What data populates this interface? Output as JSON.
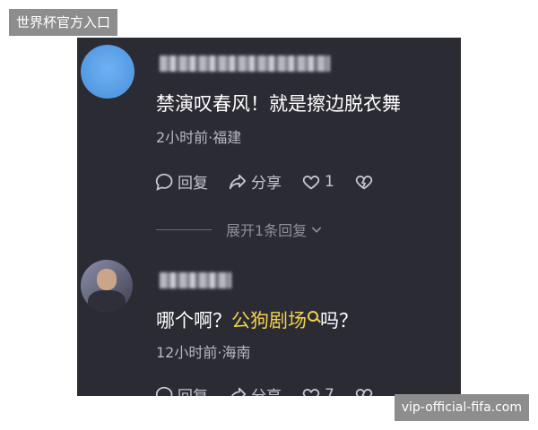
{
  "watermark_top": "世界杯官方入口",
  "watermark_bottom": "vip-official-fifa.com",
  "comments": [
    {
      "text": "禁演叹春风！就是擦边脱衣舞",
      "meta": "2小时前·福建",
      "reply_label": "回复",
      "share_label": "分享",
      "like_count": "1"
    },
    {
      "text_before": "哪个啊？",
      "text_highlight": "公狗剧场",
      "text_after": "吗？",
      "meta": "12小时前·海南",
      "reply_label": "回复",
      "share_label": "分享",
      "like_count": "7"
    }
  ],
  "expand_label": "展开1条回复"
}
